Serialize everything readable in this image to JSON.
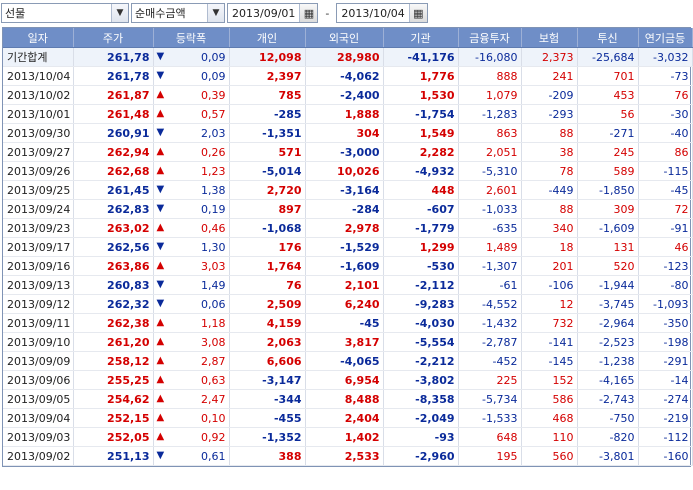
{
  "toolbar": {
    "market_select": "선물",
    "type_select": "순매수금액",
    "date_from": "2013/09/01",
    "date_sep": "-",
    "date_to": "2013/10/04"
  },
  "columns": [
    "일자",
    "주가",
    "등락폭",
    "개인",
    "외국인",
    "기관",
    "금융투자",
    "보험",
    "투신",
    "연기금등"
  ],
  "rows": [
    {
      "date": "기간합계",
      "price": "261,78",
      "dir": "down",
      "chg": "0,09",
      "indiv": "12,098",
      "foreign": "28,980",
      "inst": "-41,176",
      "fin": "-16,080",
      "ins": "2,373",
      "trust": "-25,684",
      "pension": "-3,032",
      "sum": true
    },
    {
      "date": "2013/10/04",
      "price": "261,78",
      "dir": "down",
      "chg": "0,09",
      "indiv": "2,397",
      "foreign": "-4,062",
      "inst": "1,776",
      "fin": "888",
      "ins": "241",
      "trust": "701",
      "pension": "-73"
    },
    {
      "date": "2013/10/02",
      "price": "261,87",
      "dir": "up",
      "chg": "0,39",
      "indiv": "785",
      "foreign": "-2,400",
      "inst": "1,530",
      "fin": "1,079",
      "ins": "-209",
      "trust": "453",
      "pension": "76"
    },
    {
      "date": "2013/10/01",
      "price": "261,48",
      "dir": "up",
      "chg": "0,57",
      "indiv": "-285",
      "foreign": "1,888",
      "inst": "-1,754",
      "fin": "-1,283",
      "ins": "-293",
      "trust": "56",
      "pension": "-30"
    },
    {
      "date": "2013/09/30",
      "price": "260,91",
      "dir": "down",
      "chg": "2,03",
      "indiv": "-1,351",
      "foreign": "304",
      "inst": "1,549",
      "fin": "863",
      "ins": "88",
      "trust": "-271",
      "pension": "-40"
    },
    {
      "date": "2013/09/27",
      "price": "262,94",
      "dir": "up",
      "chg": "0,26",
      "indiv": "571",
      "foreign": "-3,000",
      "inst": "2,282",
      "fin": "2,051",
      "ins": "38",
      "trust": "245",
      "pension": "86"
    },
    {
      "date": "2013/09/26",
      "price": "262,68",
      "dir": "up",
      "chg": "1,23",
      "indiv": "-5,014",
      "foreign": "10,026",
      "inst": "-4,932",
      "fin": "-5,310",
      "ins": "78",
      "trust": "589",
      "pension": "-115"
    },
    {
      "date": "2013/09/25",
      "price": "261,45",
      "dir": "down",
      "chg": "1,38",
      "indiv": "2,720",
      "foreign": "-3,164",
      "inst": "448",
      "fin": "2,601",
      "ins": "-449",
      "trust": "-1,850",
      "pension": "-45"
    },
    {
      "date": "2013/09/24",
      "price": "262,83",
      "dir": "down",
      "chg": "0,19",
      "indiv": "897",
      "foreign": "-284",
      "inst": "-607",
      "fin": "-1,033",
      "ins": "88",
      "trust": "309",
      "pension": "72"
    },
    {
      "date": "2013/09/23",
      "price": "263,02",
      "dir": "up",
      "chg": "0,46",
      "indiv": "-1,068",
      "foreign": "2,978",
      "inst": "-1,779",
      "fin": "-635",
      "ins": "340",
      "trust": "-1,609",
      "pension": "-91"
    },
    {
      "date": "2013/09/17",
      "price": "262,56",
      "dir": "down",
      "chg": "1,30",
      "indiv": "176",
      "foreign": "-1,529",
      "inst": "1,299",
      "fin": "1,489",
      "ins": "18",
      "trust": "131",
      "pension": "46"
    },
    {
      "date": "2013/09/16",
      "price": "263,86",
      "dir": "up",
      "chg": "3,03",
      "indiv": "1,764",
      "foreign": "-1,609",
      "inst": "-530",
      "fin": "-1,307",
      "ins": "201",
      "trust": "520",
      "pension": "-123"
    },
    {
      "date": "2013/09/13",
      "price": "260,83",
      "dir": "down",
      "chg": "1,49",
      "indiv": "76",
      "foreign": "2,101",
      "inst": "-2,112",
      "fin": "-61",
      "ins": "-106",
      "trust": "-1,944",
      "pension": "-80"
    },
    {
      "date": "2013/09/12",
      "price": "262,32",
      "dir": "down",
      "chg": "0,06",
      "indiv": "2,509",
      "foreign": "6,240",
      "inst": "-9,283",
      "fin": "-4,552",
      "ins": "12",
      "trust": "-3,745",
      "pension": "-1,093"
    },
    {
      "date": "2013/09/11",
      "price": "262,38",
      "dir": "up",
      "chg": "1,18",
      "indiv": "4,159",
      "foreign": "-45",
      "inst": "-4,030",
      "fin": "-1,432",
      "ins": "732",
      "trust": "-2,964",
      "pension": "-350"
    },
    {
      "date": "2013/09/10",
      "price": "261,20",
      "dir": "up",
      "chg": "3,08",
      "indiv": "2,063",
      "foreign": "3,817",
      "inst": "-5,554",
      "fin": "-2,787",
      "ins": "-141",
      "trust": "-2,523",
      "pension": "-198"
    },
    {
      "date": "2013/09/09",
      "price": "258,12",
      "dir": "up",
      "chg": "2,87",
      "indiv": "6,606",
      "foreign": "-4,065",
      "inst": "-2,212",
      "fin": "-452",
      "ins": "-145",
      "trust": "-1,238",
      "pension": "-291"
    },
    {
      "date": "2013/09/06",
      "price": "255,25",
      "dir": "up",
      "chg": "0,63",
      "indiv": "-3,147",
      "foreign": "6,954",
      "inst": "-3,802",
      "fin": "225",
      "ins": "152",
      "trust": "-4,165",
      "pension": "-14"
    },
    {
      "date": "2013/09/05",
      "price": "254,62",
      "dir": "up",
      "chg": "2,47",
      "indiv": "-344",
      "foreign": "8,488",
      "inst": "-8,358",
      "fin": "-5,734",
      "ins": "586",
      "trust": "-2,743",
      "pension": "-274"
    },
    {
      "date": "2013/09/04",
      "price": "252,15",
      "dir": "up",
      "chg": "0,10",
      "indiv": "-455",
      "foreign": "2,404",
      "inst": "-2,049",
      "fin": "-1,533",
      "ins": "468",
      "trust": "-750",
      "pension": "-219"
    },
    {
      "date": "2013/09/03",
      "price": "252,05",
      "dir": "up",
      "chg": "0,92",
      "indiv": "-1,352",
      "foreign": "1,402",
      "inst": "-93",
      "fin": "648",
      "ins": "110",
      "trust": "-820",
      "pension": "-112"
    },
    {
      "date": "2013/09/02",
      "price": "251,13",
      "dir": "down",
      "chg": "0,61",
      "indiv": "388",
      "foreign": "2,533",
      "inst": "-2,960",
      "fin": "195",
      "ins": "560",
      "trust": "-3,801",
      "pension": "-160"
    }
  ]
}
